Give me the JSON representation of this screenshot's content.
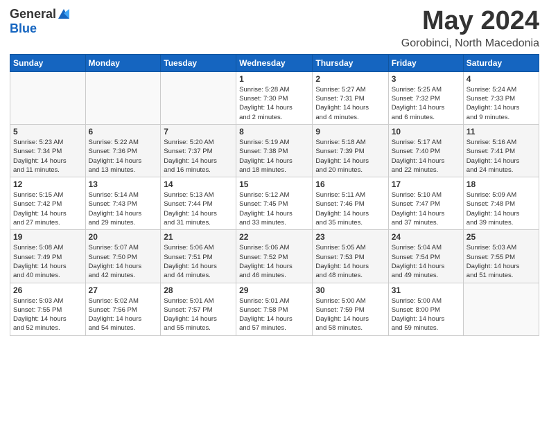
{
  "header": {
    "logo_general": "General",
    "logo_blue": "Blue",
    "month_title": "May 2024",
    "subtitle": "Gorobinci, North Macedonia"
  },
  "weekdays": [
    "Sunday",
    "Monday",
    "Tuesday",
    "Wednesday",
    "Thursday",
    "Friday",
    "Saturday"
  ],
  "weeks": [
    [
      {
        "day": "",
        "info": ""
      },
      {
        "day": "",
        "info": ""
      },
      {
        "day": "",
        "info": ""
      },
      {
        "day": "1",
        "info": "Sunrise: 5:28 AM\nSunset: 7:30 PM\nDaylight: 14 hours\nand 2 minutes."
      },
      {
        "day": "2",
        "info": "Sunrise: 5:27 AM\nSunset: 7:31 PM\nDaylight: 14 hours\nand 4 minutes."
      },
      {
        "day": "3",
        "info": "Sunrise: 5:25 AM\nSunset: 7:32 PM\nDaylight: 14 hours\nand 6 minutes."
      },
      {
        "day": "4",
        "info": "Sunrise: 5:24 AM\nSunset: 7:33 PM\nDaylight: 14 hours\nand 9 minutes."
      }
    ],
    [
      {
        "day": "5",
        "info": "Sunrise: 5:23 AM\nSunset: 7:34 PM\nDaylight: 14 hours\nand 11 minutes."
      },
      {
        "day": "6",
        "info": "Sunrise: 5:22 AM\nSunset: 7:36 PM\nDaylight: 14 hours\nand 13 minutes."
      },
      {
        "day": "7",
        "info": "Sunrise: 5:20 AM\nSunset: 7:37 PM\nDaylight: 14 hours\nand 16 minutes."
      },
      {
        "day": "8",
        "info": "Sunrise: 5:19 AM\nSunset: 7:38 PM\nDaylight: 14 hours\nand 18 minutes."
      },
      {
        "day": "9",
        "info": "Sunrise: 5:18 AM\nSunset: 7:39 PM\nDaylight: 14 hours\nand 20 minutes."
      },
      {
        "day": "10",
        "info": "Sunrise: 5:17 AM\nSunset: 7:40 PM\nDaylight: 14 hours\nand 22 minutes."
      },
      {
        "day": "11",
        "info": "Sunrise: 5:16 AM\nSunset: 7:41 PM\nDaylight: 14 hours\nand 24 minutes."
      }
    ],
    [
      {
        "day": "12",
        "info": "Sunrise: 5:15 AM\nSunset: 7:42 PM\nDaylight: 14 hours\nand 27 minutes."
      },
      {
        "day": "13",
        "info": "Sunrise: 5:14 AM\nSunset: 7:43 PM\nDaylight: 14 hours\nand 29 minutes."
      },
      {
        "day": "14",
        "info": "Sunrise: 5:13 AM\nSunset: 7:44 PM\nDaylight: 14 hours\nand 31 minutes."
      },
      {
        "day": "15",
        "info": "Sunrise: 5:12 AM\nSunset: 7:45 PM\nDaylight: 14 hours\nand 33 minutes."
      },
      {
        "day": "16",
        "info": "Sunrise: 5:11 AM\nSunset: 7:46 PM\nDaylight: 14 hours\nand 35 minutes."
      },
      {
        "day": "17",
        "info": "Sunrise: 5:10 AM\nSunset: 7:47 PM\nDaylight: 14 hours\nand 37 minutes."
      },
      {
        "day": "18",
        "info": "Sunrise: 5:09 AM\nSunset: 7:48 PM\nDaylight: 14 hours\nand 39 minutes."
      }
    ],
    [
      {
        "day": "19",
        "info": "Sunrise: 5:08 AM\nSunset: 7:49 PM\nDaylight: 14 hours\nand 40 minutes."
      },
      {
        "day": "20",
        "info": "Sunrise: 5:07 AM\nSunset: 7:50 PM\nDaylight: 14 hours\nand 42 minutes."
      },
      {
        "day": "21",
        "info": "Sunrise: 5:06 AM\nSunset: 7:51 PM\nDaylight: 14 hours\nand 44 minutes."
      },
      {
        "day": "22",
        "info": "Sunrise: 5:06 AM\nSunset: 7:52 PM\nDaylight: 14 hours\nand 46 minutes."
      },
      {
        "day": "23",
        "info": "Sunrise: 5:05 AM\nSunset: 7:53 PM\nDaylight: 14 hours\nand 48 minutes."
      },
      {
        "day": "24",
        "info": "Sunrise: 5:04 AM\nSunset: 7:54 PM\nDaylight: 14 hours\nand 49 minutes."
      },
      {
        "day": "25",
        "info": "Sunrise: 5:03 AM\nSunset: 7:55 PM\nDaylight: 14 hours\nand 51 minutes."
      }
    ],
    [
      {
        "day": "26",
        "info": "Sunrise: 5:03 AM\nSunset: 7:55 PM\nDaylight: 14 hours\nand 52 minutes."
      },
      {
        "day": "27",
        "info": "Sunrise: 5:02 AM\nSunset: 7:56 PM\nDaylight: 14 hours\nand 54 minutes."
      },
      {
        "day": "28",
        "info": "Sunrise: 5:01 AM\nSunset: 7:57 PM\nDaylight: 14 hours\nand 55 minutes."
      },
      {
        "day": "29",
        "info": "Sunrise: 5:01 AM\nSunset: 7:58 PM\nDaylight: 14 hours\nand 57 minutes."
      },
      {
        "day": "30",
        "info": "Sunrise: 5:00 AM\nSunset: 7:59 PM\nDaylight: 14 hours\nand 58 minutes."
      },
      {
        "day": "31",
        "info": "Sunrise: 5:00 AM\nSunset: 8:00 PM\nDaylight: 14 hours\nand 59 minutes."
      },
      {
        "day": "",
        "info": ""
      }
    ]
  ]
}
